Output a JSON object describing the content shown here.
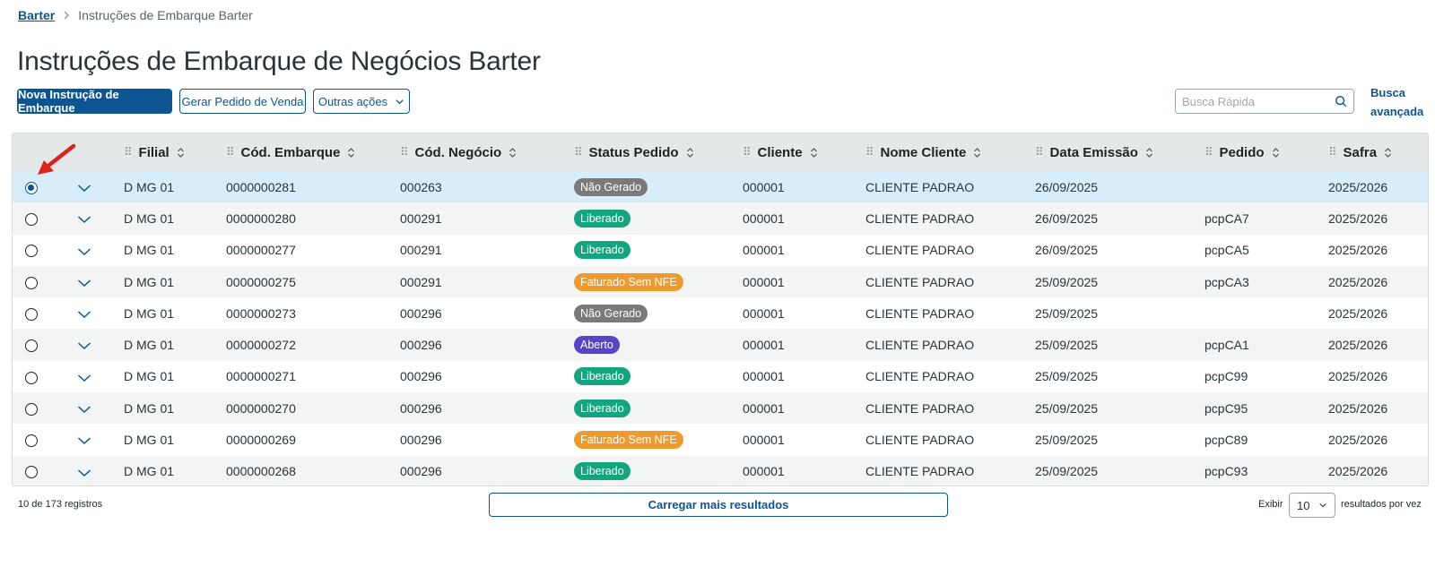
{
  "breadcrumb": {
    "root": "Barter",
    "current": "Instruções de Embarque Barter"
  },
  "title": "Instruções de Embarque de Negócios Barter",
  "toolbar": {
    "primary": "Nova Instrução de Embarque",
    "generate": "Gerar Pedido de Venda",
    "other_actions": "Outras ações"
  },
  "search": {
    "placeholder": "Busca Rápida",
    "advanced_line1": "Busca",
    "advanced_line2": "avançada"
  },
  "table": {
    "columns": [
      "Filial",
      "Cód. Embarque",
      "Cód. Negócio",
      "Status Pedido",
      "Cliente",
      "Nome Cliente",
      "Data Emissão",
      "Pedido",
      "Safra"
    ],
    "status_colors": {
      "Não Gerado": "#7a7a7a",
      "Liberado": "#13a57e",
      "Faturado Sem NFE": "#ef9a2d",
      "Aberto": "#5a43c9"
    },
    "rows": [
      {
        "filial": "D MG 01",
        "embarque": "0000000281",
        "negocio": "000263",
        "status": "Não Gerado",
        "cliente": "000001",
        "nome": "CLIENTE PADRAO",
        "data": "26/09/2025",
        "pedido": "",
        "safra": "2025/2026",
        "selected": true
      },
      {
        "filial": "D MG 01",
        "embarque": "0000000280",
        "negocio": "000291",
        "status": "Liberado",
        "cliente": "000001",
        "nome": "CLIENTE PADRAO",
        "data": "26/09/2025",
        "pedido": "pcpCA7",
        "safra": "2025/2026",
        "selected": false
      },
      {
        "filial": "D MG 01",
        "embarque": "0000000277",
        "negocio": "000291",
        "status": "Liberado",
        "cliente": "000001",
        "nome": "CLIENTE PADRAO",
        "data": "26/09/2025",
        "pedido": "pcpCA5",
        "safra": "2025/2026",
        "selected": false
      },
      {
        "filial": "D MG 01",
        "embarque": "0000000275",
        "negocio": "000291",
        "status": "Faturado Sem NFE",
        "cliente": "000001",
        "nome": "CLIENTE PADRAO",
        "data": "25/09/2025",
        "pedido": "pcpCA3",
        "safra": "2025/2026",
        "selected": false
      },
      {
        "filial": "D MG 01",
        "embarque": "0000000273",
        "negocio": "000296",
        "status": "Não Gerado",
        "cliente": "000001",
        "nome": "CLIENTE PADRAO",
        "data": "25/09/2025",
        "pedido": "",
        "safra": "2025/2026",
        "selected": false
      },
      {
        "filial": "D MG 01",
        "embarque": "0000000272",
        "negocio": "000296",
        "status": "Aberto",
        "cliente": "000001",
        "nome": "CLIENTE PADRAO",
        "data": "25/09/2025",
        "pedido": "pcpCA1",
        "safra": "2025/2026",
        "selected": false
      },
      {
        "filial": "D MG 01",
        "embarque": "0000000271",
        "negocio": "000296",
        "status": "Liberado",
        "cliente": "000001",
        "nome": "CLIENTE PADRAO",
        "data": "25/09/2025",
        "pedido": "pcpC99",
        "safra": "2025/2026",
        "selected": false
      },
      {
        "filial": "D MG 01",
        "embarque": "0000000270",
        "negocio": "000296",
        "status": "Liberado",
        "cliente": "000001",
        "nome": "CLIENTE PADRAO",
        "data": "25/09/2025",
        "pedido": "pcpC95",
        "safra": "2025/2026",
        "selected": false
      },
      {
        "filial": "D MG 01",
        "embarque": "0000000269",
        "negocio": "000296",
        "status": "Faturado Sem NFE",
        "cliente": "000001",
        "nome": "CLIENTE PADRAO",
        "data": "25/09/2025",
        "pedido": "pcpC89",
        "safra": "2025/2026",
        "selected": false
      },
      {
        "filial": "D MG 01",
        "embarque": "0000000268",
        "negocio": "000296",
        "status": "Liberado",
        "cliente": "000001",
        "nome": "CLIENTE PADRAO",
        "data": "25/09/2025",
        "pedido": "pcpC93",
        "safra": "2025/2026",
        "selected": false
      }
    ]
  },
  "footer": {
    "count": "10 de 173 registros",
    "load_more": "Carregar mais resultados",
    "show_label": "Exibir",
    "per_page": "10",
    "per_page_suffix": "resultados por vez"
  }
}
